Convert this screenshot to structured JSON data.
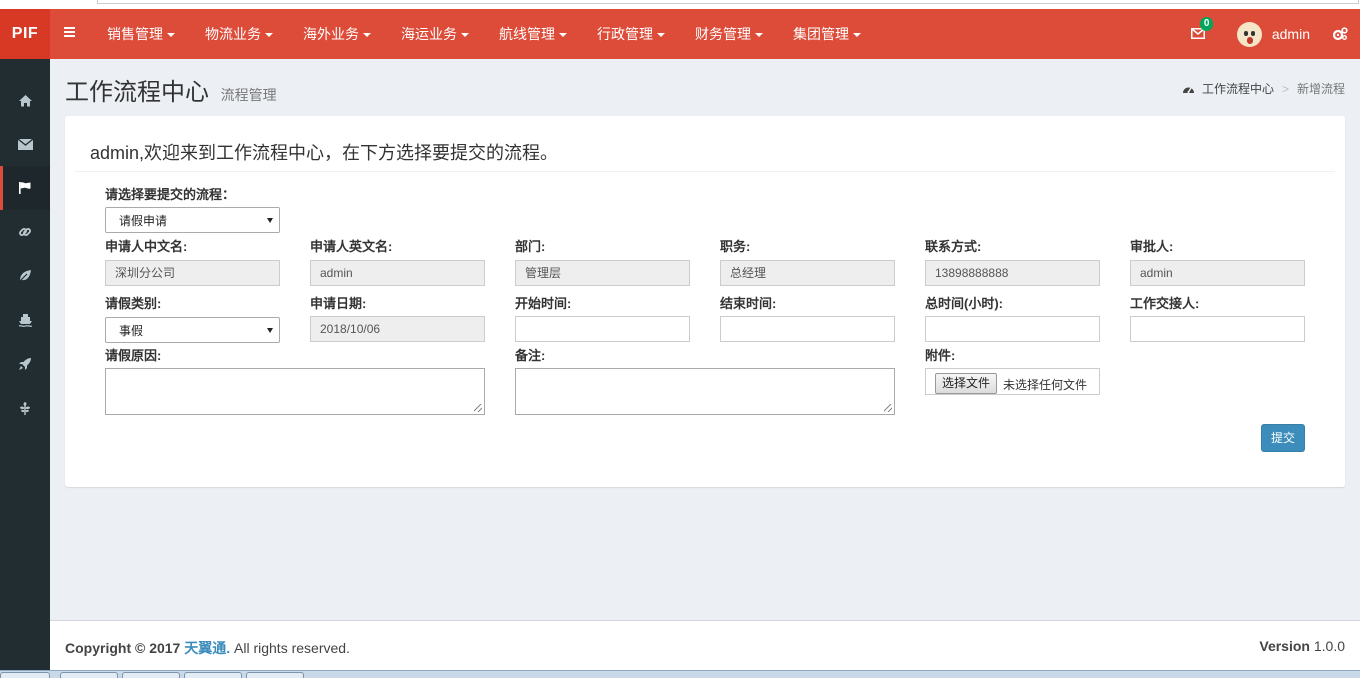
{
  "header": {
    "logo": "PIF",
    "nav": [
      {
        "label": "销售管理"
      },
      {
        "label": "物流业务"
      },
      {
        "label": "海外业务"
      },
      {
        "label": "海运业务"
      },
      {
        "label": "航线管理"
      },
      {
        "label": "行政管理"
      },
      {
        "label": "财务管理"
      },
      {
        "label": "集团管理"
      }
    ],
    "mail_count": "0",
    "username": "admin",
    "accent_color": "#dd4b39"
  },
  "sidebar": {
    "items": [
      {
        "icon": "home-icon"
      },
      {
        "icon": "envelope-icon"
      },
      {
        "icon": "flag-icon",
        "active": true
      },
      {
        "icon": "link-icon"
      },
      {
        "icon": "leaf-icon"
      },
      {
        "icon": "ship-icon"
      },
      {
        "icon": "rocket-icon"
      },
      {
        "icon": "pagelines-icon"
      }
    ]
  },
  "page": {
    "title": "工作流程中心",
    "subtitle": "流程管理",
    "breadcrumb": {
      "home": "工作流程中心",
      "current": "新增流程"
    }
  },
  "box": {
    "welcome": "admin,欢迎来到工作流程中心，在下方选择要提交的流程。"
  },
  "form": {
    "process_label": "请选择要提交的流程：",
    "process_value": "请假申请",
    "cn_name_label": "申请人中文名:",
    "cn_name_value": "深圳分公司",
    "en_name_label": "申请人英文名:",
    "en_name_value": "admin",
    "dept_label": "部门:",
    "dept_value": "管理层",
    "position_label": "职务:",
    "position_value": "总经理",
    "contact_label": "联系方式:",
    "contact_value": "13898888888",
    "approver_label": "审批人:",
    "approver_value": "admin",
    "leave_type_label": "请假类别:",
    "leave_type_value": "事假",
    "apply_date_label": "申请日期:",
    "apply_date_value": "2018/10/06",
    "start_label": "开始时间:",
    "end_label": "结束时间:",
    "total_label": "总时间(小时):",
    "handover_label": "工作交接人:",
    "reason_label": "请假原因:",
    "remark_label": "备注:",
    "attach_label": "附件:",
    "file_button": "选择文件",
    "file_status": "未选择任何文件",
    "submit": "提交"
  },
  "footer": {
    "copyright_prefix": "Copyright © 2017",
    "company": "天翼通.",
    "rights": "All rights reserved.",
    "version_label": "Version",
    "version_value": "1.0.0"
  }
}
